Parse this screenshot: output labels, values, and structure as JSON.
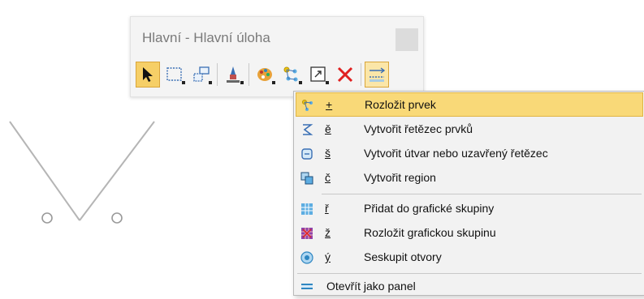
{
  "window": {
    "title": "Hlavní - Hlavní úloha"
  },
  "toolbar": {
    "buttons": [
      {
        "name": "select-tool",
        "icon": "cursor-arrow-icon",
        "state": "active"
      },
      {
        "name": "rectangle-select-tool",
        "icon": "dashed-rectangle-icon",
        "state": "normal"
      },
      {
        "name": "window-select-tool",
        "icon": "window-select-icon",
        "state": "normal"
      },
      {
        "name": "edit-tool",
        "icon": "pen-tool-icon",
        "state": "normal"
      },
      {
        "name": "palette-tool",
        "icon": "color-palette-icon",
        "state": "normal"
      },
      {
        "name": "nodes-tool",
        "icon": "nodes-icon",
        "state": "normal"
      },
      {
        "name": "zoom-window-tool",
        "icon": "zoom-window-icon",
        "state": "normal"
      },
      {
        "name": "delete-tool",
        "icon": "red-x-delete-icon",
        "state": "normal"
      },
      {
        "name": "explode-tool",
        "icon": "explode-icon",
        "state": "open"
      }
    ]
  },
  "context_menu": {
    "items": [
      {
        "accel": "+",
        "label": "Rozložit prvek",
        "icon": "explode-element-icon",
        "highlighted": true
      },
      {
        "accel": "ě",
        "label": "Vytvořit řetězec prvků",
        "icon": "chain-icon"
      },
      {
        "accel": "š",
        "label": "Vytvořit útvar nebo uzavřený řetězec",
        "icon": "closed-shape-icon"
      },
      {
        "accel": "č",
        "label": "Vytvořit region",
        "icon": "region-icon"
      },
      {
        "accel": "ř",
        "label": "Přidat do grafické skupiny",
        "icon": "add-group-icon"
      },
      {
        "accel": "ž",
        "label": "Rozložit grafickou skupinu",
        "icon": "explode-group-icon"
      },
      {
        "accel": "ý",
        "label": "Seskupit otvory",
        "icon": "group-holes-icon"
      }
    ],
    "panel_item": {
      "label": "Otevřít jako panel",
      "icon": "open-panel-icon"
    }
  },
  "colors": {
    "highlight": "#f9d978",
    "active_tool": "#f6cf67",
    "delete_red": "#e02020",
    "drawing_line": "#b5b5b5"
  }
}
